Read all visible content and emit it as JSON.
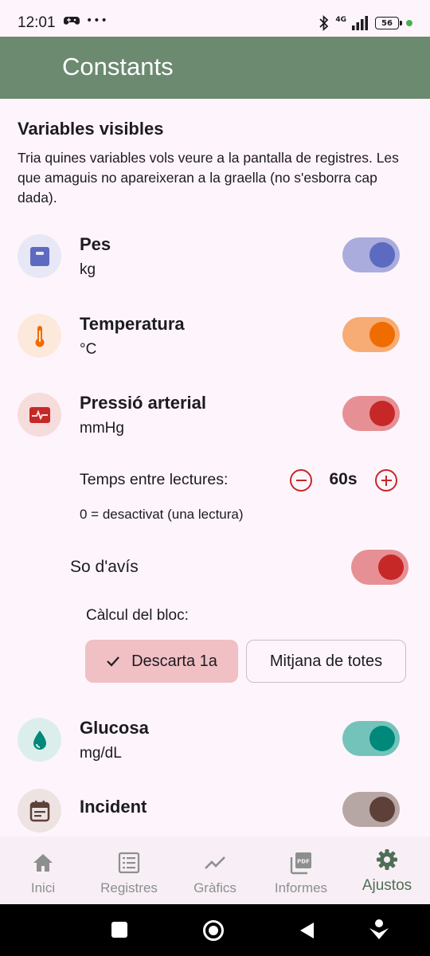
{
  "status": {
    "time": "12:01",
    "more": "•••",
    "network": "4G",
    "battery": "56",
    "icons": [
      "gamepad-icon",
      "bluetooth-icon",
      "signal-icon",
      "battery-icon",
      "dot-icon"
    ]
  },
  "appbar": {
    "title": "Constants"
  },
  "section": {
    "title": "Variables visibles",
    "description": "Tria quines variables vols veure a la pantalla de registres. Les que amaguis no apareixeran a la graella (no s'esborra cap dada)."
  },
  "variables": [
    {
      "name": "Pes",
      "unit": "kg",
      "icon": "scale-icon",
      "enabled": true,
      "color": "#5c6bc0"
    },
    {
      "name": "Temperatura",
      "unit": "°C",
      "icon": "thermometer-icon",
      "enabled": true,
      "color": "#ef6c00"
    },
    {
      "name": "Pressió arterial",
      "unit": "mmHg",
      "icon": "heart-monitor-icon",
      "enabled": true,
      "color": "#c62828"
    },
    {
      "name": "Glucosa",
      "unit": "mg/dL",
      "icon": "drop-icon",
      "enabled": true,
      "color": "#00897b"
    },
    {
      "name": "Incident",
      "unit": "",
      "icon": "calendar-icon",
      "enabled": true,
      "color": "#5d4037"
    }
  ],
  "pressure": {
    "interval_label": "Temps entre lectures:",
    "interval_value": "60s",
    "interval_hint": "0 = desactivat (una lectura)",
    "sound_label": "So d'avís",
    "sound_enabled": true,
    "calc_label": "Càlcul del bloc:",
    "calc_options": [
      "Descarta 1a",
      "Mitjana de totes"
    ],
    "calc_selected": "Descarta 1a"
  },
  "nav": {
    "items": [
      {
        "label": "Inici",
        "icon": "home-icon"
      },
      {
        "label": "Registres",
        "icon": "list-icon"
      },
      {
        "label": "Gràfics",
        "icon": "chart-icon"
      },
      {
        "label": "Informes",
        "icon": "pdf-icon"
      },
      {
        "label": "Ajustos",
        "icon": "gear-icon"
      }
    ],
    "active": "Ajustos",
    "active_color": "#4f6f55"
  },
  "colors": {
    "appbar": "#6b8a70",
    "background": "#fdf5fb",
    "accent_red": "#c62828"
  }
}
